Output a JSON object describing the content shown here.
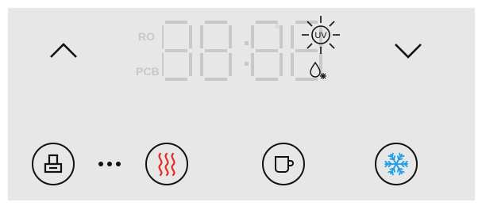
{
  "display": {
    "label_ro": "RO",
    "label_pcb": "PCB",
    "digits": "88:88",
    "degree_symbol": "°",
    "uv_label": "UV"
  },
  "icons": {
    "up": "chevron-up-icon",
    "down": "chevron-down-icon",
    "sun_uv": "uv-sun-icon",
    "drop": "water-drop-icon",
    "faucet": "faucet-icon",
    "heat": "heat-waves-icon",
    "cup": "cup-icon",
    "snowflake": "snowflake-icon"
  },
  "colors": {
    "panel": "#e7e7e8",
    "segments": "#c8c8c8",
    "heat": "#e32a23",
    "cold": "#1e9fe8",
    "outline": "#111111"
  }
}
